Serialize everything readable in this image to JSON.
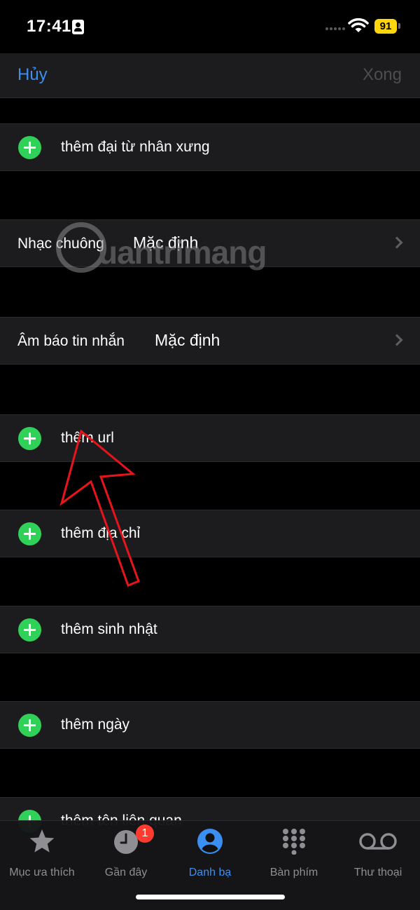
{
  "status": {
    "time": "17:41",
    "battery": "91"
  },
  "nav": {
    "cancel": "Hủy",
    "done": "Xong"
  },
  "rows": {
    "pronoun": "thêm đại từ nhân xưng",
    "ringtone_label": "Nhạc chuông",
    "ringtone_value": "Mặc định",
    "text_tone_label": "Âm báo tin nhắn",
    "text_tone_value": "Mặc định",
    "url": "thêm url",
    "address": "thêm địa chỉ",
    "birthday": "thêm sinh nhật",
    "date": "thêm ngày",
    "related_name": "thêm tên liên quan"
  },
  "watermark": {
    "text": "uantrimang"
  },
  "tabs": [
    {
      "label": "Mục ưa thích",
      "icon": "star-icon",
      "active": false
    },
    {
      "label": "Gần đây",
      "icon": "clock-icon",
      "active": false,
      "badge": "1"
    },
    {
      "label": "Danh bạ",
      "icon": "contact-icon",
      "active": true
    },
    {
      "label": "Bàn phím",
      "icon": "keypad-icon",
      "active": false
    },
    {
      "label": "Thư thoại",
      "icon": "voicemail-icon",
      "active": false
    }
  ],
  "colors": {
    "accent": "#3b8ef2",
    "add": "#30d158",
    "badge": "#ff3b30",
    "battery": "#ffd60a",
    "annotation": "#e8141c"
  }
}
